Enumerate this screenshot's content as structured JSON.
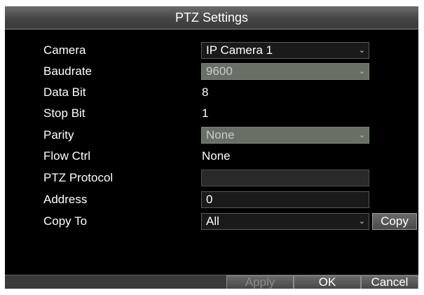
{
  "dialog": {
    "title": "PTZ Settings"
  },
  "fields": {
    "camera": {
      "label": "Camera",
      "value": "IP Camera 1"
    },
    "baudrate": {
      "label": "Baudrate",
      "value": "9600"
    },
    "data_bit": {
      "label": "Data Bit",
      "value": "8"
    },
    "stop_bit": {
      "label": "Stop Bit",
      "value": "1"
    },
    "parity": {
      "label": "Parity",
      "value": "None"
    },
    "flow_ctrl": {
      "label": "Flow Ctrl",
      "value": "None"
    },
    "ptz_protocol": {
      "label": "PTZ Protocol",
      "value": ""
    },
    "address": {
      "label": "Address",
      "value": "0"
    },
    "copy_to": {
      "label": "Copy To",
      "value": "All",
      "button": "Copy"
    }
  },
  "footer": {
    "apply": "Apply",
    "ok": "OK",
    "cancel": "Cancel"
  },
  "icons": {
    "dropdown": "chevron-down-icon"
  },
  "colors": {
    "background": "#000000",
    "disabled_field": "#687066",
    "title_bar": "#4a4a4a"
  }
}
